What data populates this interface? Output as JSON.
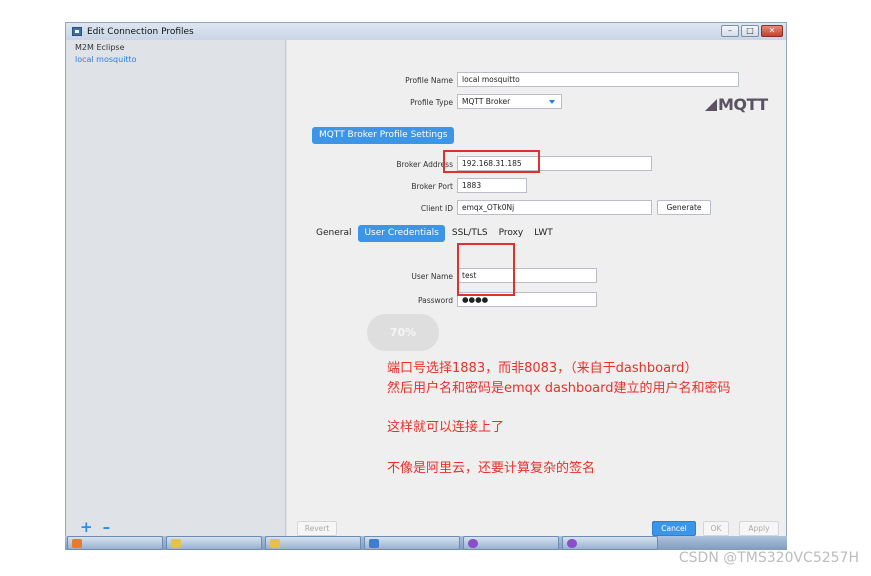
{
  "window": {
    "title": "Edit Connection Profiles",
    "buttons": {
      "minimize": "–",
      "maximize": "□",
      "close": "✕"
    }
  },
  "profiles": {
    "items": [
      {
        "label": "M2M Eclipse",
        "selected": false
      },
      {
        "label": "local mosquitto",
        "selected": true
      }
    ],
    "add_label": "+",
    "remove_label": "–"
  },
  "form": {
    "profile_name_label": "Profile Name",
    "profile_name_value": "local mosquitto",
    "profile_type_label": "Profile Type",
    "profile_type_value": "MQTT Broker",
    "logo_text": "MQTT",
    "section_button": "MQTT Broker Profile Settings",
    "broker_address_label": "Broker Address",
    "broker_address_value": "192.168.31.185",
    "broker_port_label": "Broker Port",
    "broker_port_value": "1883",
    "client_id_label": "Client ID",
    "client_id_value": "emqx_OTk0Nj",
    "generate_label": "Generate"
  },
  "tabs": [
    {
      "label": "General",
      "active": false
    },
    {
      "label": "User Credentials",
      "active": true
    },
    {
      "label": "SSL/TLS",
      "active": false
    },
    {
      "label": "Proxy",
      "active": false
    },
    {
      "label": "LWT",
      "active": false
    }
  ],
  "credentials": {
    "username_label": "User Name",
    "username_value": "test",
    "password_label": "Password",
    "password_value": "●●●●"
  },
  "progress": {
    "label": "70%",
    "value": 0.7
  },
  "footer": {
    "revert_label": "Revert",
    "cancel_label": "Cancel",
    "ok_label": "OK",
    "apply_label": "Apply"
  },
  "annotation": {
    "line1": "端口号选择1883，而非8083，（来自于dashboard）",
    "line2": "然后用户名和密码是emqx dashboard建立的用户名和密码",
    "line3": "这样就可以连接上了",
    "line4": "不像是阿里云，还要计算复杂的签名"
  },
  "watermark": "CSDN @TMS320VC5257H",
  "colors": {
    "accent": "#3d95e8",
    "highlight_box": "#e0322c",
    "annotation_text": "#e8302a"
  }
}
